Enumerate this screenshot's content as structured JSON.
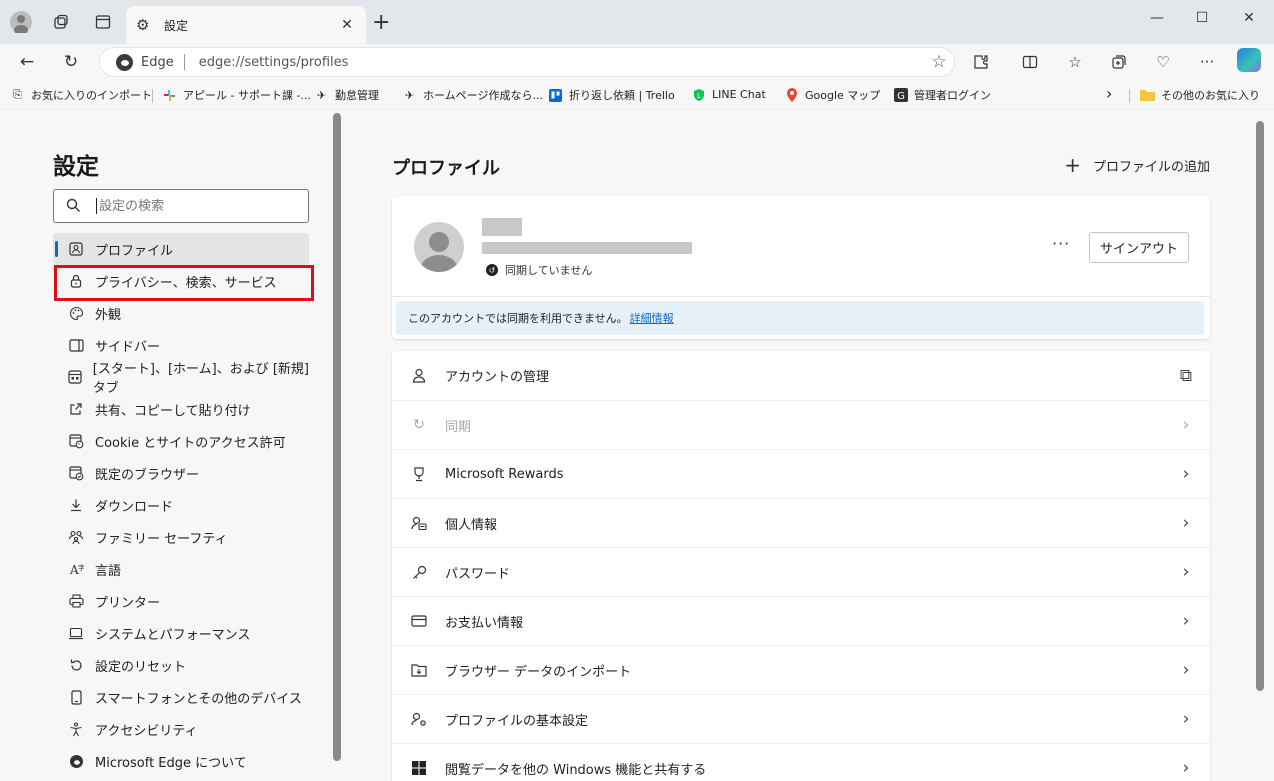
{
  "tab": {
    "title": "設定",
    "close": "✕"
  },
  "window": {
    "minimize": "—",
    "maximize": "☐",
    "close": "✕"
  },
  "address": {
    "site_label": "Edge",
    "url": "edge://settings/profiles"
  },
  "favorites": [
    {
      "label": "お気に入りのインポート",
      "icon": "import-icon"
    },
    {
      "label": "アピール - サポート課 -...",
      "icon": "slack-icon"
    },
    {
      "label": "勤怠管理",
      "icon": "bird-icon"
    },
    {
      "label": "ホームページ作成なら...",
      "icon": "bird-icon"
    },
    {
      "label": "折り返し依頼 | Trello",
      "icon": "trello-icon"
    },
    {
      "label": "LINE Chat",
      "icon": "line-icon"
    },
    {
      "label": "Google マップ",
      "icon": "maps-icon"
    },
    {
      "label": "管理者ログイン",
      "icon": "admin-icon"
    },
    {
      "label": "その他のお気に入り",
      "icon": "folder-icon"
    }
  ],
  "sidebar": {
    "title": "設定",
    "search_placeholder": "設定の検索",
    "items": [
      {
        "label": "プロファイル",
        "icon": "profile-icon",
        "active": true
      },
      {
        "label": "プライバシー、検索、サービス",
        "icon": "lock-icon"
      },
      {
        "label": "外観",
        "icon": "palette-icon"
      },
      {
        "label": "サイドバー",
        "icon": "sidebar-icon"
      },
      {
        "label": "[スタート]、[ホーム]、および [新規] タブ",
        "icon": "home-tab-icon"
      },
      {
        "label": "共有、コピーして貼り付け",
        "icon": "share-icon"
      },
      {
        "label": "Cookie とサイトのアクセス許可",
        "icon": "cookie-icon"
      },
      {
        "label": "既定のブラウザー",
        "icon": "browser-icon"
      },
      {
        "label": "ダウンロード",
        "icon": "download-icon"
      },
      {
        "label": "ファミリー セーフティ",
        "icon": "family-icon"
      },
      {
        "label": "言語",
        "icon": "language-icon"
      },
      {
        "label": "プリンター",
        "icon": "printer-icon"
      },
      {
        "label": "システムとパフォーマンス",
        "icon": "laptop-icon"
      },
      {
        "label": "設定のリセット",
        "icon": "reset-icon"
      },
      {
        "label": "スマートフォンとその他のデバイス",
        "icon": "phone-icon"
      },
      {
        "label": "アクセシビリティ",
        "icon": "accessibility-icon"
      },
      {
        "label": "Microsoft Edge について",
        "icon": "edge-icon"
      }
    ]
  },
  "main": {
    "title": "プロファイル",
    "add_profile": "プロファイルの追加",
    "profile": {
      "sync_status": "同期していません",
      "more": "···",
      "signout": "サインアウト",
      "banner_text": "このアカウントでは同期を利用できません。",
      "banner_link": "詳細情報"
    },
    "rows": [
      {
        "label": "アカウントの管理",
        "icon": "person-icon",
        "trail": "⧉",
        "disabled": false
      },
      {
        "label": "同期",
        "icon": "sync-icon",
        "trail": "›",
        "disabled": true
      },
      {
        "label": "Microsoft Rewards",
        "icon": "trophy-icon",
        "trail": "›",
        "disabled": false
      },
      {
        "label": "個人情報",
        "icon": "contact-card-icon",
        "trail": "›",
        "disabled": false
      },
      {
        "label": "パスワード",
        "icon": "key-icon",
        "trail": "›",
        "disabled": false
      },
      {
        "label": "お支払い情報",
        "icon": "credit-card-icon",
        "trail": "›",
        "disabled": false
      },
      {
        "label": "ブラウザー データのインポート",
        "icon": "import-folder-icon",
        "trail": "›",
        "disabled": false
      },
      {
        "label": "プロファイルの基本設定",
        "icon": "person-settings-icon",
        "trail": "›",
        "disabled": false
      },
      {
        "label": "閲覧データを他の Windows 機能と共有する",
        "icon": "windows-icon",
        "trail": "›",
        "disabled": false
      }
    ]
  }
}
